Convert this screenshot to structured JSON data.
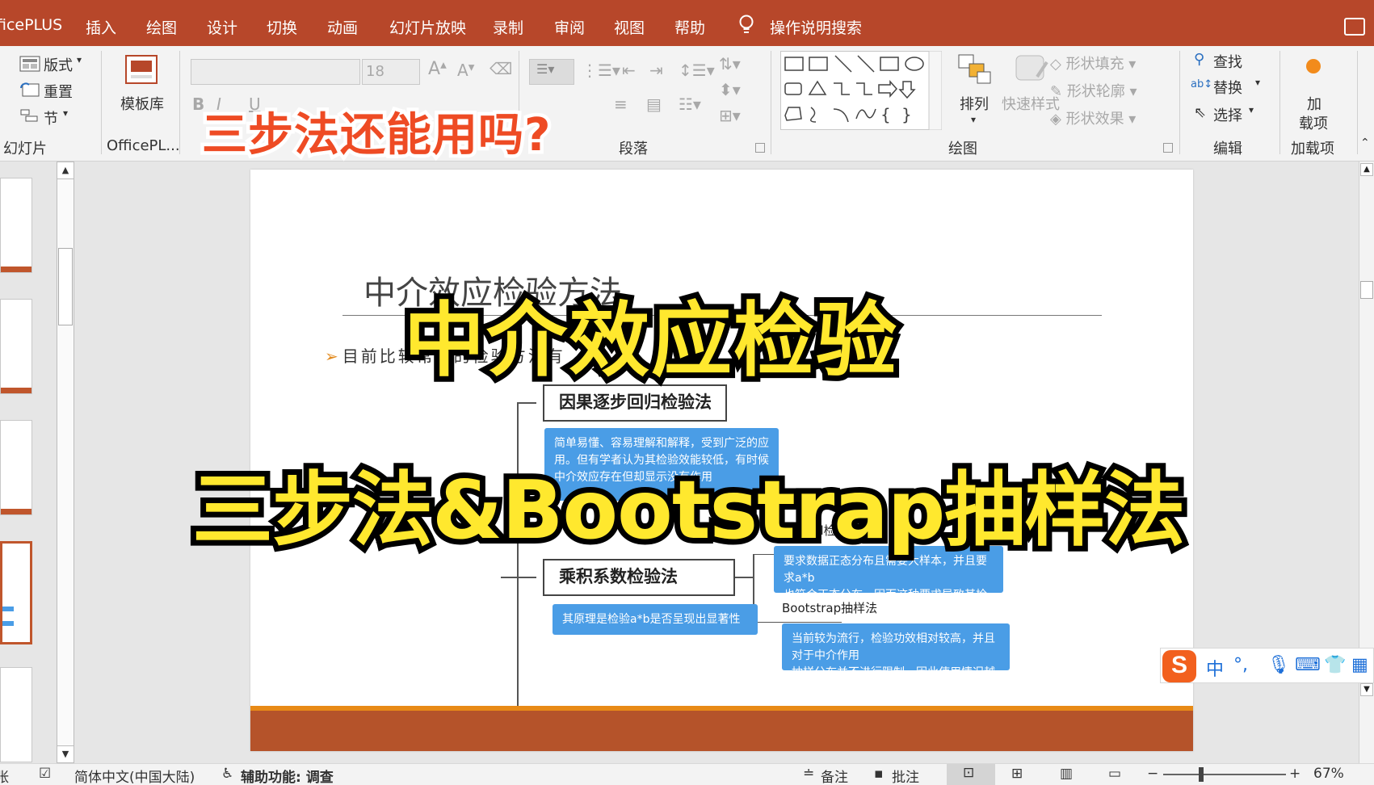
{
  "menu": {
    "tabs": [
      "ficePLUS",
      "插入",
      "绘图",
      "设计",
      "切换",
      "动画",
      "幻灯片放映",
      "录制",
      "审阅",
      "视图",
      "帮助"
    ],
    "search": "操作说明搜索"
  },
  "ribbon": {
    "slides_group": {
      "layout": "版式",
      "reset": "重置",
      "section": "节",
      "label": "幻灯片"
    },
    "officeplus_group": {
      "template_lib": "模板库",
      "label": "OfficePL..."
    },
    "font_group": {
      "font_size": "18"
    },
    "paragraph_group": {
      "label": "段落"
    },
    "drawing_group": {
      "arrange": "排列",
      "quick_styles": "快速样式",
      "shape_fill": "形状填充",
      "shape_outline": "形状轮廓",
      "shape_effects": "形状效果",
      "label": "绘图"
    },
    "editing_group": {
      "find": "查找",
      "replace": "替换",
      "select": "选择",
      "label": "编辑"
    },
    "addins_group": {
      "add_line1": "加",
      "add_line2": "载项",
      "label": "加载项"
    }
  },
  "overlay": {
    "question": "三步法还能用吗?",
    "headline": "中介效应检验",
    "subheadline": "三步法&Bootstrap抽样法"
  },
  "slide": {
    "title": "中介效应检验方法",
    "bullet": "目前比较常用的检验方法有",
    "node1": "因果逐步回归检验法",
    "note1": "简单易懂、容易理解和解释，受到广泛的应用。但有学者认为其检验效能较低，有时候中介效应存在但却显示没有作用",
    "node2": "乘积系数检验法",
    "note2": "其原理是检验a*b是否呈现出显著性",
    "sobel_label": "Sobel检验",
    "note3_line1": "要求数据正态分布且需要大样本，并且要求a*b",
    "note3_line2": "也符合正态分布，因而这种要求导致其检验功效较低。",
    "bootstrap_label": "Bootstrap抽样法",
    "note4_line1": "当前较为流行，检验功效相对较高，并且对于中介作用",
    "note4_line2": "抽样分布并不进行限制，因此使用情况越来越多。"
  },
  "ime": {
    "logo": "S",
    "mode": "中",
    "punct": "°,"
  },
  "status": {
    "left_fragment": "张",
    "language": "简体中文(中国大陆)",
    "accessibility": "辅助功能: 调查",
    "notes": "备注",
    "comments": "批注",
    "zoom": "67%"
  },
  "colors": {
    "accent": "#b7472a",
    "overlay_yellow": "#ffe82e",
    "overlay_red": "#ee4b24",
    "note_blue": "#4a9de6",
    "footer_orange": "#e88a16"
  }
}
